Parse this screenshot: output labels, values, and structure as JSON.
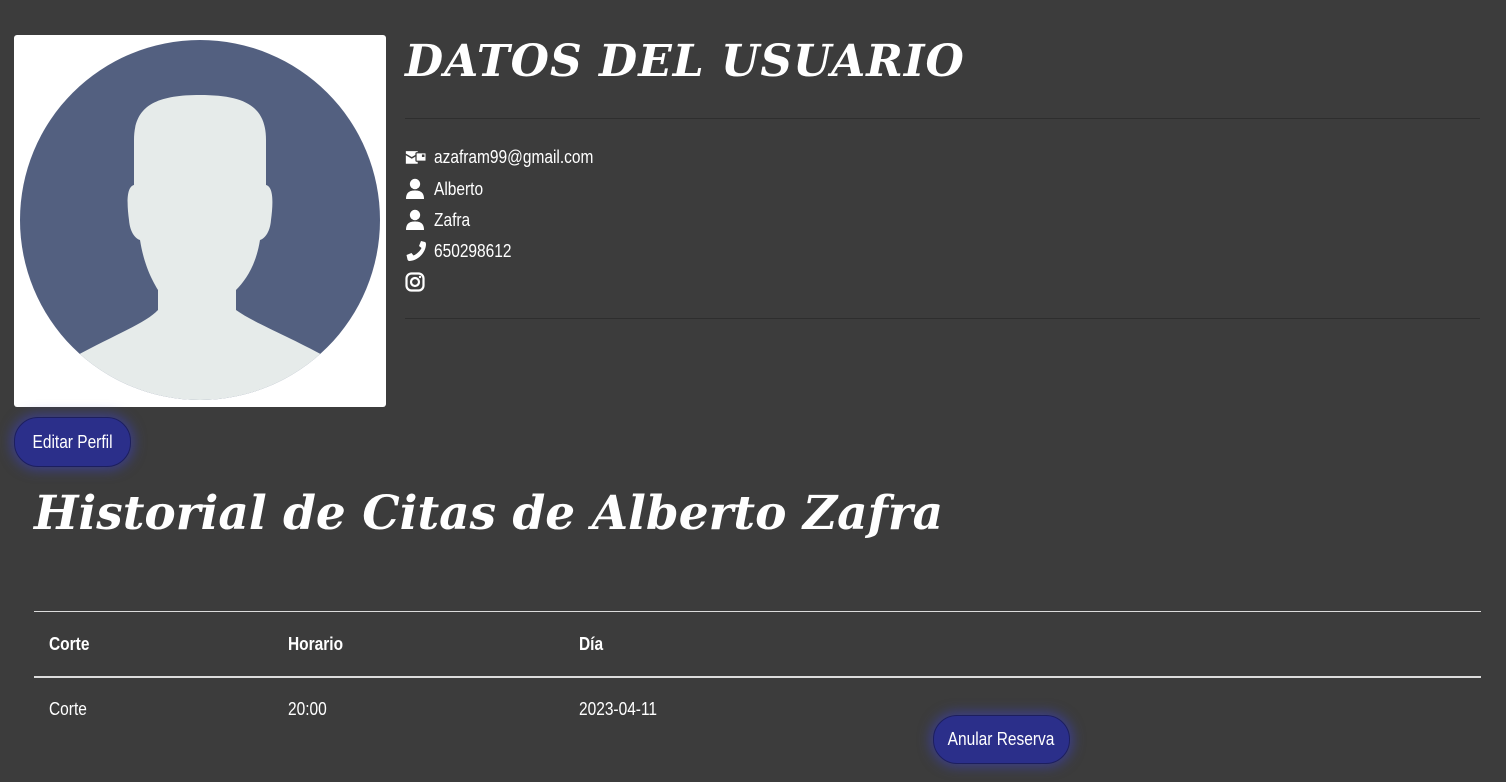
{
  "user": {
    "title": "DATOS DEL USUARIO",
    "email": "azafram99@gmail.com",
    "first_name": "Alberto",
    "last_name": "Zafra",
    "phone": "650298612",
    "instagram": ""
  },
  "icons": {
    "avatar": "user-avatar-placeholder",
    "email": "envelope-icon",
    "name": "user-icon",
    "surname": "user-icon",
    "phone": "phone-icon",
    "instagram": "instagram-icon"
  },
  "buttons": {
    "edit_profile": "Editar Perfil",
    "cancel_booking": "Anular Reserva"
  },
  "history": {
    "title": "Historial de Citas de Alberto Zafra",
    "columns": [
      "Corte",
      "Horario",
      "Día"
    ],
    "rows": [
      {
        "service": "Corte",
        "time": "20:00",
        "date": "2023-04-11"
      }
    ]
  },
  "colors": {
    "background": "#3c3c3c",
    "avatar_bg": "#536080",
    "avatar_fg": "#e6ebea",
    "button": "#2b2f8a"
  }
}
